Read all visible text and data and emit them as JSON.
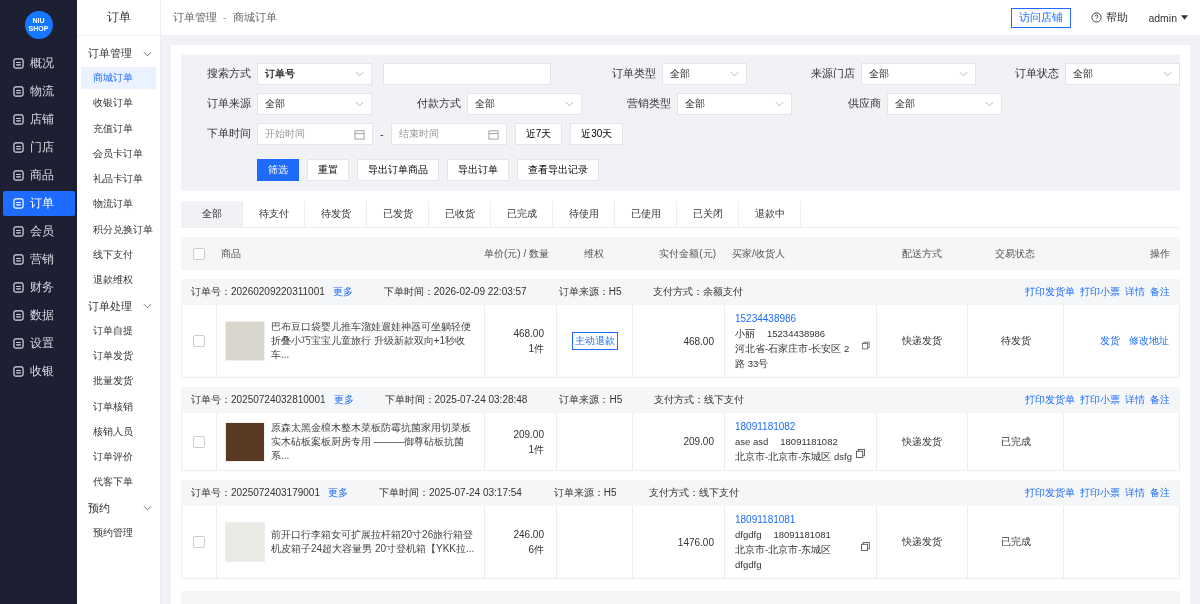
{
  "logo": {
    "line1": "NIU",
    "line2": "SHOP"
  },
  "nav": [
    {
      "label": "概况",
      "selected": false
    },
    {
      "label": "物流",
      "selected": false
    },
    {
      "label": "店铺",
      "selected": false
    },
    {
      "label": "门店",
      "selected": false
    },
    {
      "label": "商品",
      "selected": false
    },
    {
      "label": "订单",
      "selected": true
    },
    {
      "label": "会员",
      "selected": false
    },
    {
      "label": "营销",
      "selected": false
    },
    {
      "label": "财务",
      "selected": false
    },
    {
      "label": "数据",
      "selected": false
    },
    {
      "label": "设置",
      "selected": false
    },
    {
      "label": "收银",
      "selected": false
    }
  ],
  "submenu": {
    "title": "订单",
    "groups": [
      {
        "label": "订单管理",
        "expanded": true,
        "items": [
          {
            "label": "商城订单",
            "selected": true
          },
          {
            "label": "收银订单",
            "selected": false
          },
          {
            "label": "充值订单",
            "selected": false
          },
          {
            "label": "会员卡订单",
            "selected": false
          },
          {
            "label": "礼品卡订单",
            "selected": false
          },
          {
            "label": "物流订单",
            "selected": false
          },
          {
            "label": "积分兑换订单",
            "selected": false
          },
          {
            "label": "线下支付",
            "selected": false
          },
          {
            "label": "退款维权",
            "selected": false
          }
        ]
      },
      {
        "label": "订单处理",
        "expanded": true,
        "items": [
          {
            "label": "订单自提",
            "selected": false
          },
          {
            "label": "订单发货",
            "selected": false
          },
          {
            "label": "批量发货",
            "selected": false
          },
          {
            "label": "订单核销",
            "selected": false
          },
          {
            "label": "核销人员",
            "selected": false
          },
          {
            "label": "订单评价",
            "selected": false
          },
          {
            "label": "代客下单",
            "selected": false
          }
        ]
      },
      {
        "label": "预约",
        "expanded": true,
        "items": [
          {
            "label": "预约管理",
            "selected": false
          }
        ]
      }
    ]
  },
  "breadcrumb": [
    "订单管理",
    "商城订单"
  ],
  "breadcrumb_separator": "-",
  "topbar": {
    "visit_button": "访问店铺",
    "help": "帮助",
    "user": "admin"
  },
  "filters": {
    "row1": [
      {
        "label": "搜索方式",
        "value": "订单号",
        "kind": "select"
      },
      {
        "kind": "input"
      },
      {
        "label": "订单类型",
        "value": "全部",
        "kind": "select"
      },
      {
        "label": "来源门店",
        "value": "全部",
        "kind": "select"
      },
      {
        "label": "订单状态",
        "value": "全部",
        "kind": "select"
      }
    ],
    "row2": [
      {
        "label": "订单来源",
        "value": "全部"
      },
      {
        "label": "付款方式",
        "value": "全部"
      },
      {
        "label": "营销类型",
        "value": "全部"
      },
      {
        "label": "供应商",
        "value": "全部"
      }
    ],
    "time_label": "下单时间",
    "start_placeholder": "开始时间",
    "range_separator": "-",
    "end_placeholder": "结束时间",
    "quick": [
      "近7天",
      "近30天"
    ],
    "buttons": [
      {
        "label": "筛选",
        "primary": true
      },
      {
        "label": "重置",
        "primary": false
      },
      {
        "label": "导出订单商品",
        "primary": false
      },
      {
        "label": "导出订单",
        "primary": false
      },
      {
        "label": "查看导出记录",
        "primary": false
      }
    ]
  },
  "tabs": [
    {
      "label": "全部",
      "selected": true
    },
    {
      "label": "待支付",
      "selected": false
    },
    {
      "label": "待发货",
      "selected": false
    },
    {
      "label": "已发货",
      "selected": false
    },
    {
      "label": "已收货",
      "selected": false
    },
    {
      "label": "已完成",
      "selected": false
    },
    {
      "label": "待使用",
      "selected": false
    },
    {
      "label": "已使用",
      "selected": false
    },
    {
      "label": "已关闭",
      "selected": false
    },
    {
      "label": "退款中",
      "selected": false
    }
  ],
  "table": {
    "all_checked": false,
    "columns": [
      "商品",
      "单价(元) / 数量",
      "维权",
      "实付金额(元)",
      "买家/收货人",
      "配送方式",
      "交易状态",
      "操作"
    ],
    "orders": [
      {
        "order_no_label": "订单号：",
        "order_no": "20260209220311001",
        "more": "更多",
        "time": "下单时间：2026-02-09 22:03:57",
        "source": "订单来源：H5",
        "pay": "支付方式：余额支付",
        "actions": [
          "打印发货单",
          "打印小票",
          "详情",
          "备注"
        ],
        "title": "巴布豆口袋婴儿推车溜娃遛娃神器可坐躺轻便折叠小巧宝宝儿童旅行 升级新款双向+1秒收车...",
        "price": "468.00",
        "qty": "1件",
        "refund": "主动退款",
        "paid": "468.00",
        "buyer_phone": "15234438986",
        "name": "小丽",
        "phone": "15234438986",
        "address": "河北省-石家庄市-长安区 2路 33号",
        "delivery": "快递发货",
        "status": "待发货",
        "ops": [
          "发货",
          "修改地址"
        ],
        "checked": false
      },
      {
        "order_no_label": "订单号：",
        "order_no": "20250724032810001",
        "more": "更多",
        "time": "下单时间：2025-07-24 03:28:48",
        "source": "订单来源：H5",
        "pay": "支付方式：线下支付",
        "actions": [
          "打印发货单",
          "打印小票",
          "详情",
          "备注"
        ],
        "title": "原森太黑金檀木整木菜板防霉抗菌家用切菜板实木砧板案板厨房专用 ———御尊砧板抗菌系...",
        "price": "209.00",
        "qty": "1件",
        "paid": "209.00",
        "buyer_phone": "18091181082",
        "name": "ase asd",
        "phone": "18091181082",
        "address": "北京市-北京市-东城区 dsfg",
        "delivery": "快递发货",
        "status": "已完成",
        "checked": false
      },
      {
        "order_no_label": "订单号：",
        "order_no": "2025072403179001",
        "more": "更多",
        "time": "下单时间：2025-07-24 03:17:54",
        "source": "订单来源：H5",
        "pay": "支付方式：线下支付",
        "actions": [
          "打印发货单",
          "打印小票",
          "详情",
          "备注"
        ],
        "title": "前开口行李箱女可扩展拉杆箱20寸26旅行箱登机皮箱子24超大容量男 20寸登机箱【YKK拉...",
        "price": "246.00",
        "qty": "6件",
        "paid": "1476.00",
        "buyer_phone": "18091181081",
        "name": "dfgdfg",
        "phone": "18091181081",
        "address": "北京市-北京市-东城区 dfgdfg",
        "delivery": "快递发货",
        "status": "已完成",
        "checked": false
      }
    ]
  }
}
